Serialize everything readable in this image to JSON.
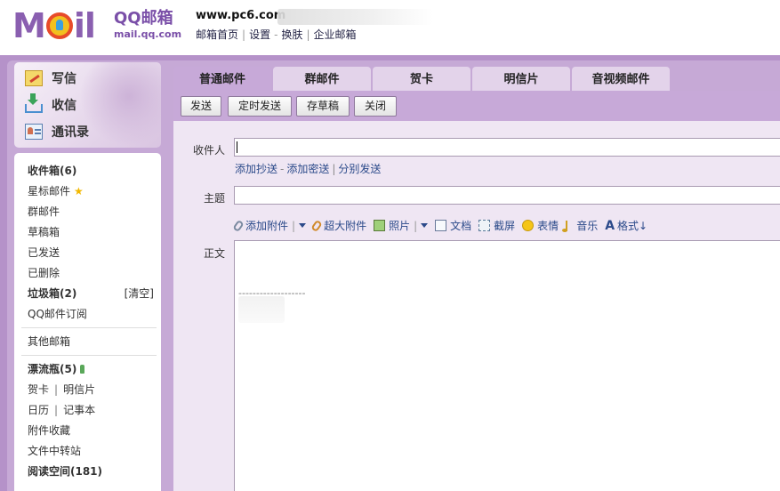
{
  "header": {
    "logo_text": "MOil",
    "logo_qq": "QQ邮箱",
    "logo_url": "mail.qq.com",
    "site_name": "www.pc6.com",
    "links": [
      "邮箱首页",
      "设置",
      "换肤",
      "企业邮箱"
    ]
  },
  "quick": {
    "write": "写信",
    "inbox": "收信",
    "contacts": "通讯录"
  },
  "folders": {
    "inbox": "收件箱(6)",
    "starred": "星标邮件",
    "group": "群邮件",
    "drafts": "草稿箱",
    "sent": "已发送",
    "deleted": "已删除",
    "spam": "垃圾箱(2)",
    "spam_clear": "[清空]",
    "subscription": "QQ邮件订阅",
    "other": "其他邮箱",
    "bottle": "漂流瓶(5)",
    "greeting_card": "贺卡",
    "postcard": "明信片",
    "calendar": "日历",
    "notebook": "记事本",
    "attachments": "附件收藏",
    "file_transfer": "文件中转站",
    "reading": "阅读空间(181)"
  },
  "tabs": [
    "普通邮件",
    "群邮件",
    "贺卡",
    "明信片",
    "音视频邮件"
  ],
  "toolbar": {
    "send": "发送",
    "timed_send": "定时发送",
    "save_draft": "存草稿",
    "close": "关闭"
  },
  "compose": {
    "to_label": "收件人",
    "to_value": "",
    "add_cc": "添加抄送",
    "add_bcc": "添加密送",
    "separate_send": "分别发送",
    "subject_label": "主题",
    "subject_value": "",
    "body_label": "正文",
    "signature_dashes": "-------------------"
  },
  "attach_bar": {
    "add_attachment": "添加附件",
    "large_attachment": "超大附件",
    "photo": "照片",
    "document": "文档",
    "screenshot": "截屏",
    "emoji": "表情",
    "music": "音乐",
    "format": "格式↓"
  },
  "colors": {
    "brand_purple": "#b592c9",
    "tab_active": "#c7a9d8",
    "tab_inactive": "#e3d3ea",
    "compose_bg": "#efe6f3",
    "link_blue": "#2b4a8a"
  }
}
